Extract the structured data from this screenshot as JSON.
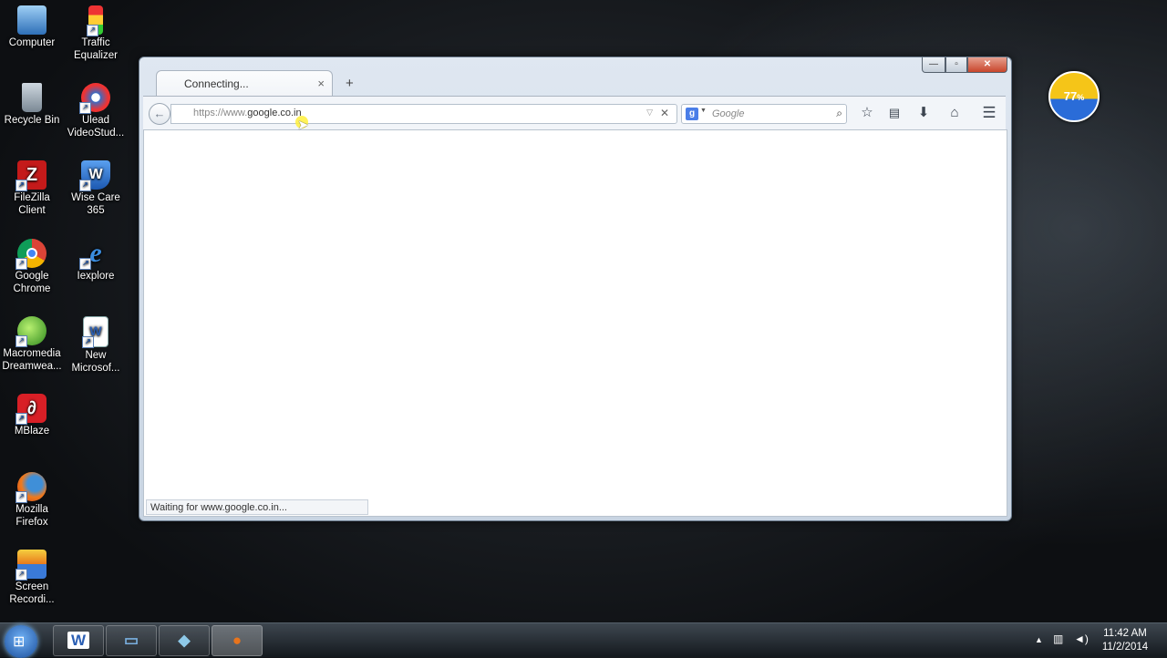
{
  "desktop": {
    "icons": [
      {
        "label1": "Computer",
        "label2": ""
      },
      {
        "label1": "Traffic",
        "label2": "Equalizer"
      },
      {
        "label1": "Recycle Bin",
        "label2": ""
      },
      {
        "label1": "Ulead",
        "label2": "VideoStud..."
      },
      {
        "label1": "FileZilla",
        "label2": "Client"
      },
      {
        "label1": "Wise Care",
        "label2": "365"
      },
      {
        "label1": "Google",
        "label2": "Chrome"
      },
      {
        "label1": "Iexplore",
        "label2": ""
      },
      {
        "label1": "Macromedia",
        "label2": "Dreamwea..."
      },
      {
        "label1": "New",
        "label2": "Microsof..."
      },
      {
        "label1": "MBlaze",
        "label2": ""
      },
      {
        "label1": "Mozilla",
        "label2": "Firefox"
      },
      {
        "label1": "Screen",
        "label2": "Recordi..."
      }
    ]
  },
  "gauge": {
    "value": "77",
    "unit": "%"
  },
  "browser": {
    "window_controls": {
      "minimize": "—",
      "maximize": "▫",
      "close": "✕"
    },
    "tab": {
      "title": "Connecting...",
      "close": "×"
    },
    "new_tab": "+",
    "url": {
      "prefix": "https://www.",
      "domain": "google.co.in"
    },
    "search": {
      "engine_letter": "g",
      "placeholder": "Google"
    },
    "status": "Waiting for www.google.co.in..."
  },
  "taskbar": {
    "buttons": [
      {
        "glyph": "W",
        "color": "#2b5fb4"
      },
      {
        "glyph": "▭",
        "color": "#7ab0e0"
      },
      {
        "glyph": "◆",
        "color": "#8ec9e8"
      },
      {
        "glyph": "●",
        "color": "#e8741c"
      }
    ],
    "clock": {
      "time": "11:42 AM",
      "date": "11/2/2014"
    }
  }
}
